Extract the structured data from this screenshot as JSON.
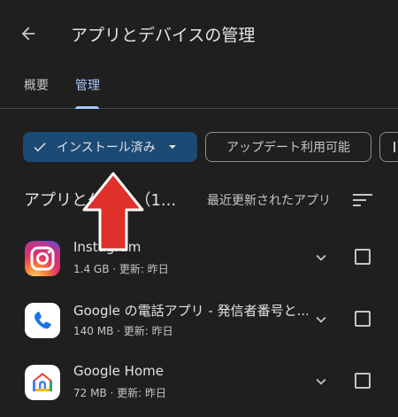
{
  "header": {
    "title": "アプリとデバイスの管理"
  },
  "tabs": [
    {
      "label": "概要",
      "selected": false
    },
    {
      "label": "管理",
      "selected": true
    }
  ],
  "filters": {
    "installed_label": "インストール済み",
    "updates_label": "アップデート利用可能"
  },
  "section": {
    "title": "アプリとゲーム（1...",
    "sort_label": "最近更新されたアプリ"
  },
  "apps": [
    {
      "name": "Instagram",
      "size": "1.4 GB",
      "updated": "更新: 昨日",
      "icon": "instagram-icon"
    },
    {
      "name": "Google の電話アプリ - 発信者番号と...",
      "size": "140 MB",
      "updated": "更新: 昨日",
      "icon": "phone-icon"
    },
    {
      "name": "Google Home",
      "size": "72 MB",
      "updated": "更新: 昨日",
      "icon": "google-home-icon"
    }
  ],
  "colors": {
    "background": "#1f1f1f",
    "accent": "#a8c7fa",
    "chip_selected": "#1b4a75",
    "annotation_arrow": "#e0302a"
  }
}
